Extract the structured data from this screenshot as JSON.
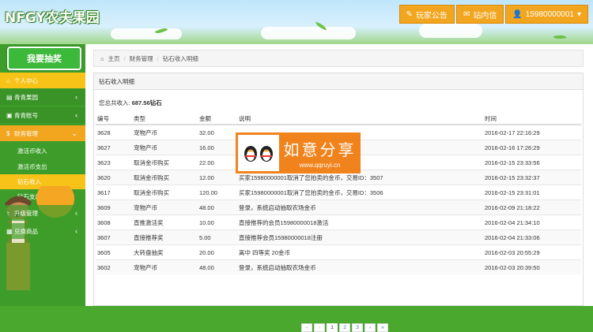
{
  "header": {
    "logo_latin": "NFGY",
    "logo_cn": "农夫果园",
    "buttons": [
      {
        "icon": "bullhorn-icon",
        "label": "玩家公告"
      },
      {
        "icon": "envelope-icon",
        "label": "站内信"
      },
      {
        "icon": "user-icon",
        "label": "15980000001"
      }
    ]
  },
  "sidebar": {
    "lottery_button": "我要抽奖",
    "items": [
      {
        "label": "个人中心"
      },
      {
        "label": "青青果园"
      },
      {
        "label": "青青账号"
      },
      {
        "label": "财务管理"
      }
    ],
    "sub_items": [
      "激活币收入",
      "激活币支出",
      "钻石收入",
      "钻石支出"
    ],
    "items_after": [
      {
        "label": "升级管理"
      },
      {
        "label": "兑换商品"
      }
    ]
  },
  "breadcrumb": [
    "主页",
    "财务管理",
    "钻石收入明细"
  ],
  "panel": {
    "title": "钻石收入明细",
    "total_label": "您总共收入:",
    "total_value": "687.56钻石"
  },
  "table": {
    "headers": [
      "编号",
      "类型",
      "金额",
      "说明",
      "时间"
    ],
    "rows": [
      [
        "3628",
        "宠物产币",
        "32.00",
        "",
        "2016-02-17 22:16:29"
      ],
      [
        "3627",
        "宠物产币",
        "16.00",
        "",
        "2016-02-16 17:26:29"
      ],
      [
        "3623",
        "取消金币购买",
        "22.00",
        "ID：3508",
        "2016-02-15 23:33:56"
      ],
      [
        "3620",
        "取消金币购买",
        "12.00",
        "买家15980000001取消了您拍卖的金币，交易ID：3507",
        "2016-02-15 23:32:37"
      ],
      [
        "3617",
        "取消金币购买",
        "120.00",
        "买家15980000001取消了您拍卖的金币，交易ID：3506",
        "2016-02-15 23:31:01"
      ],
      [
        "3609",
        "宠物产币",
        "48.00",
        "登录，系统启动抽取农场金币",
        "2016-02-09 21:18:22"
      ],
      [
        "3608",
        "直推激活奖",
        "10.00",
        "直接推荐的会员15980000018激活",
        "2016-02-04 21:34:10"
      ],
      [
        "3607",
        "直接推荐奖",
        "5.00",
        "直接推荐会员15980000018注册",
        "2016-02-04 21:33:06"
      ],
      [
        "3605",
        "大转盘抽奖",
        "20.00",
        "离中 四等奖 20金币",
        "2016-02-03 20:55:29"
      ],
      [
        "3602",
        "宠物产币",
        "48.00",
        "登录，系统启动抽取农场金币",
        "2016-02-03 20:39:50"
      ]
    ]
  },
  "pager": [
    "«",
    "‹",
    "1",
    "2",
    "3",
    "›",
    "»"
  ],
  "watermark": {
    "title": "如意分享",
    "url": "www.qqruyi.cn"
  },
  "colors": {
    "accent_orange": "#f2a51e",
    "sidebar_green": "#3e9d2a",
    "active_yellow": "#f7c318"
  }
}
